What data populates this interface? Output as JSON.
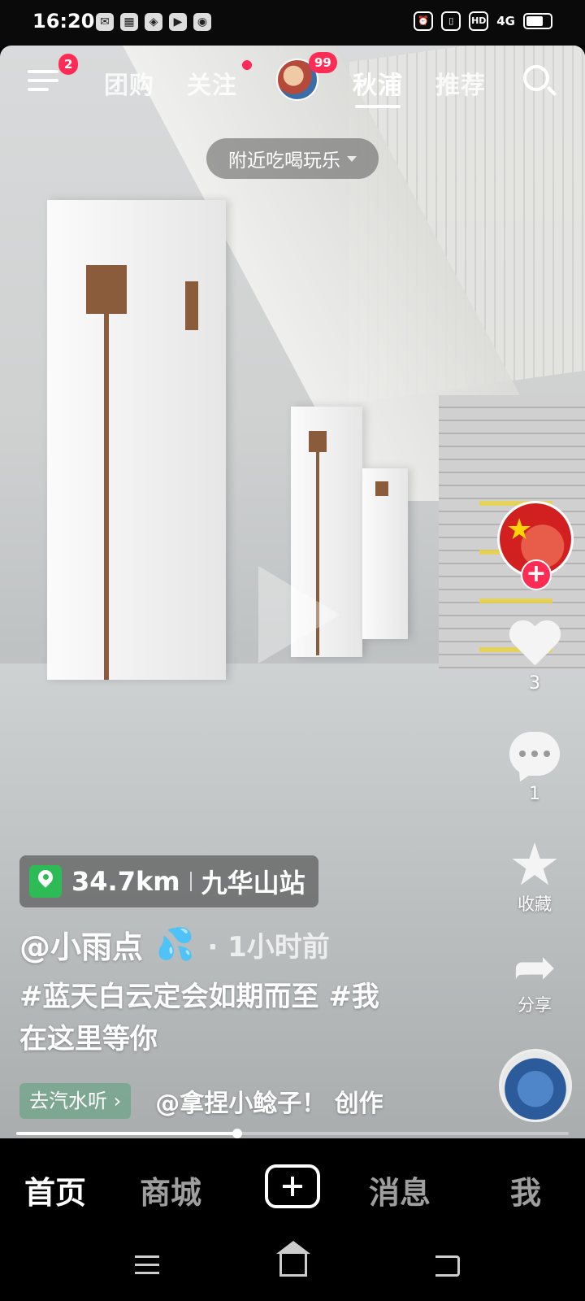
{
  "status_bar": {
    "time": "16:20",
    "network": "4G",
    "hd_label": "HD"
  },
  "top_nav": {
    "menu_badge": "2",
    "tabs": [
      {
        "label": "团购"
      },
      {
        "label": "关注"
      },
      {
        "label": "秋浦"
      },
      {
        "label": "推荐"
      }
    ],
    "friends_badge": "99",
    "active_tab": "秋浦"
  },
  "nearby_filter": {
    "label": "附近吃喝玩乐"
  },
  "right_rail": {
    "like_count": "3",
    "comment_count": "1",
    "favorite_label": "收藏",
    "share_label": "分享"
  },
  "post": {
    "location_distance": "34.7km",
    "location_name": "九华山站",
    "author": "@小雨点",
    "author_emoji": "💦",
    "time_ago": "· 1小时前",
    "caption_line1": "#蓝天白云定会如期而至 #我",
    "caption_line2": "在这里等你",
    "music_chip": "去汽水听 ›",
    "music_credit": "@拿捏小鲶子！ 创作",
    "progress": 0.4
  },
  "bottom_tabs": [
    {
      "label": "首页"
    },
    {
      "label": "商城"
    },
    {
      "label": "消息"
    },
    {
      "label": "我"
    }
  ],
  "colors": {
    "accent_red": "#fe2c55",
    "location_green": "#2cbb55"
  }
}
